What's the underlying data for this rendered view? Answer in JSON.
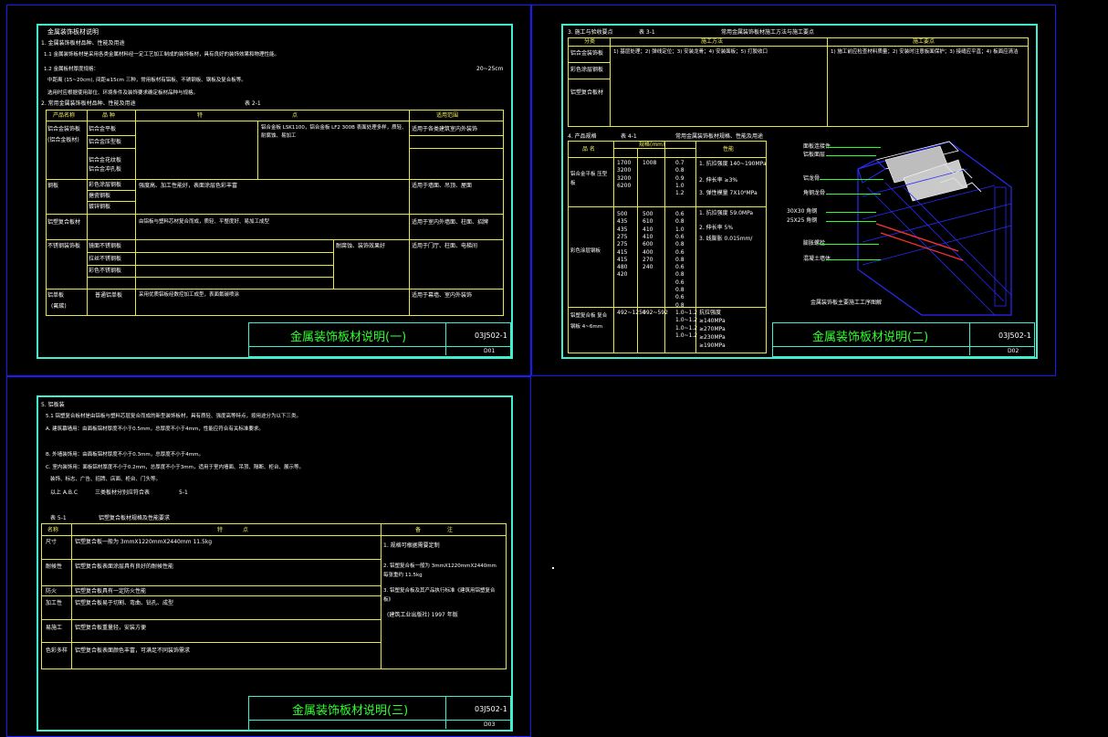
{
  "sheet1": {
    "heading": "金属装饰板材说明",
    "section1": "1. 金属装饰板材品种、性能及用途",
    "line_1_1": "1.1 金属装饰板材是采用各类金属材料经一定工艺加工制成的装饰板材，具有良好的装饰效果和物理性能。",
    "line_1_2a": "1.2 金属板材厚度规格：",
    "line_1_2_range": "20~25cm",
    "line_1_2b": "中距离 (15~20cm), 间距≤15cm 三种，常用板材有铝板、不锈钢板、钢板及复合板等。",
    "line_1_2c": "选用时应根据使用部位、环境条件及装饰要求确定板材品种与规格。",
    "section2": "2. 常用金属装饰板材品种、性能及用途",
    "table_caption": "表 2-1",
    "table_header": [
      "产品名称",
      "品  种",
      "特",
      "点",
      "适用范围"
    ],
    "rows": [
      {
        "name": "铝合金装饰板",
        "sub": "(铝合金板材)",
        "kind": [
          "铝合金平板",
          "铝合金压型板",
          "铝合金花纹板",
          "铝合金冲孔板"
        ],
        "feature": "铝合金板 LSK1100，铝合金板 LF2 300B 表面处理多样，质轻、耐腐蚀、易加工",
        "use": "适用于各类建筑室内外装饰"
      },
      {
        "name": "钢板",
        "sub": "",
        "kind": [
          "彩色涂层钢板",
          "搪瓷钢板",
          "镀锌钢板"
        ],
        "feature": "强度高、加工性能好，表面涂层色彩丰富",
        "use": "适用于墙面、吊顶、屋面"
      },
      {
        "name": "铝塑复合板材",
        "sub": "",
        "kind": [],
        "feature": "由铝板与塑料芯材复合而成，质轻、平整度好、易加工成型",
        "use": "适用于室内外墙面、柱面、招牌"
      },
      {
        "name": "不锈钢装饰板",
        "sub": "",
        "kind": [
          "镜面不锈钢板",
          "拉丝不锈钢板",
          "彩色不锈钢板"
        ],
        "feature": "耐腐蚀、装饰效果好",
        "use": "适用于门厅、柱面、电梯间"
      },
      {
        "name": "铝单板",
        "sub": "(氟碳)",
        "kind": [
          "普通铝单板"
        ],
        "feature": "采用优质铝板经数控加工成型，表面氟碳喷涂",
        "use": "适用于幕墙、室内外装饰"
      }
    ],
    "title": "金属装饰板材说明(一)",
    "code": "03J502-1",
    "page": "D01"
  },
  "sheet2": {
    "section3": "3. 施工与验收要点",
    "table_caption": "表 3-1",
    "table_title": "常用金属装饰板材施工方法与施工要点",
    "header": [
      "分类",
      "施工方法",
      "施工要点"
    ],
    "left_items": [
      "铝合金装饰板",
      "彩色涂层钢板",
      "铝塑复合板材"
    ],
    "method_text": "1) 基层处理；2) 弹线定位；3) 安装龙骨；4) 安装面板；5) 打胶收口",
    "point_text": "1) 施工前应检查材料质量；2) 安装时注意板面保护；3) 接缝应平直；4) 板面应清洁",
    "section4": "4. 产品规格",
    "spec_caption": "表 4-1",
    "spec_title": "常用金属装饰板材规格、性能及用途",
    "spec_header": [
      "品 名",
      "规格(mm)",
      "性能"
    ],
    "spec_groups": [
      {
        "name": "铝合金平板 压型板",
        "len": [
          "1700",
          "3200",
          "3200",
          "6200"
        ],
        "wid": [
          "1008"
        ],
        "thk": [
          "0.7",
          "0.8",
          "0.9",
          "1.0",
          "1.2"
        ],
        "perf": [
          "1. 抗拉强度 140~190MPa",
          "2. 伸长率 ≥3%",
          "3. 弹性模量 7X10⁴MPa"
        ]
      },
      {
        "name": "彩色涂层钢板",
        "len": [
          "500",
          "435",
          "435",
          "275",
          "275",
          "415",
          "415",
          "480",
          "420"
        ],
        "wid": [
          "500",
          "610",
          "410",
          "410",
          "600",
          "400",
          "270",
          "240"
        ],
        "thk": [
          "0.6",
          "0.8",
          "1.0",
          "0.6",
          "0.8",
          "0.6",
          "0.8",
          "0.6",
          "0.8",
          "0.6",
          "0.8",
          "0.6",
          "0.8"
        ],
        "perf": [
          "1. 抗拉强度 59.0MPa",
          "2. 伸长率 5%",
          "3. 线膨胀 0.015mm/"
        ]
      },
      {
        "name": "铝塑复合板 复合钢板 4~6mm",
        "len": [
          "492~1250"
        ],
        "wid": [
          "492~592"
        ],
        "thk": [
          "1.0~1.2",
          "1.0~1.2",
          "1.0~1.2",
          "1.0~1.2"
        ],
        "perf": [
          "抗拉强度",
          "≥140MPa",
          "≥270MPa",
          "≥230MPa",
          "≥190MPa"
        ]
      }
    ],
    "figure_labels": [
      "面板连接件",
      "铝板面层",
      "铝龙骨",
      "角钢龙骨",
      "30X30 角钢",
      "25X25 角钢",
      "膨胀螺栓",
      "混凝土墙体"
    ],
    "figure_caption": "金属装饰板主要施工工序图解",
    "title": "金属装饰板材说明(二)",
    "code": "03J502-1",
    "page": "D02"
  },
  "sheet3": {
    "section5": "5. 铝板装",
    "line_5_1": "5.1 铝塑复合板材是由铝板与塑料芯层复合而成的新型装饰板材，具有质轻、强度高等特点，按用途分为以下三类。",
    "item_a": "A. 建筑幕墙用：由面板铝材厚度不小于0.5mm，总厚度不小于4mm，性能应符合有关标准要求。",
    "item_b": "B. 外墙装饰用：由面板铝材厚度不小于0.3mm，总厚度不小于4mm。",
    "item_c": "C. 室内装饰用：面板铝材厚度不小于0.2mm，总厚度不小于3mm，适用于室内墙面、吊顶、隔断、柜台、展示等。",
    "item_c2": "装饰、标志、广告、招牌、店面、柜台、门头等。",
    "line_ab": "以上 A.B.C",
    "line_ab2": "三类板材分别应符合表",
    "line_ab3": "5-1",
    "table_caption": "表 5-1",
    "table_title": "铝塑复合板材规格及性能要求",
    "header": [
      "名称",
      "特",
      "点",
      "备",
      "注"
    ],
    "rows": [
      {
        "name": "尺寸",
        "text": "铝塑复合板一般为 3mmX1220mmX2440mm 11.5kg",
        "note": "1. 规格可根据需要定制"
      },
      {
        "name": "耐候性",
        "text": "铝塑复合板表面涂层具有良好的耐候性能",
        "note": "2. 铝塑复合板一般为 3mmX1220mmX2440mm 每张重约 11.5kg"
      },
      {
        "name": "防火",
        "text": "铝塑复合板具有一定防火性能",
        "note": "3. 铝塑复合板及其产品执行标准《建筑用铝塑复合板》"
      },
      {
        "name": "加工性",
        "text": "铝塑复合板易于切割、弯曲、钻孔、成型",
        "note": "(建筑工业出版社) 1997 年版"
      },
      {
        "name": "易施工",
        "text": "铝塑复合板重量轻，安装方便"
      },
      {
        "name": "色彩多样",
        "text": "铝塑复合板表面颜色丰富，可满足不同装饰需求"
      }
    ],
    "title": "金属装饰板材说明(三)",
    "code": "03J502-1",
    "page": "D03"
  },
  "colors": {
    "frame_blue": "#1a1aff",
    "frame_cyan": "#3ff0d0",
    "table_yellow": "#e8e84a",
    "title_green": "#30ff30"
  }
}
